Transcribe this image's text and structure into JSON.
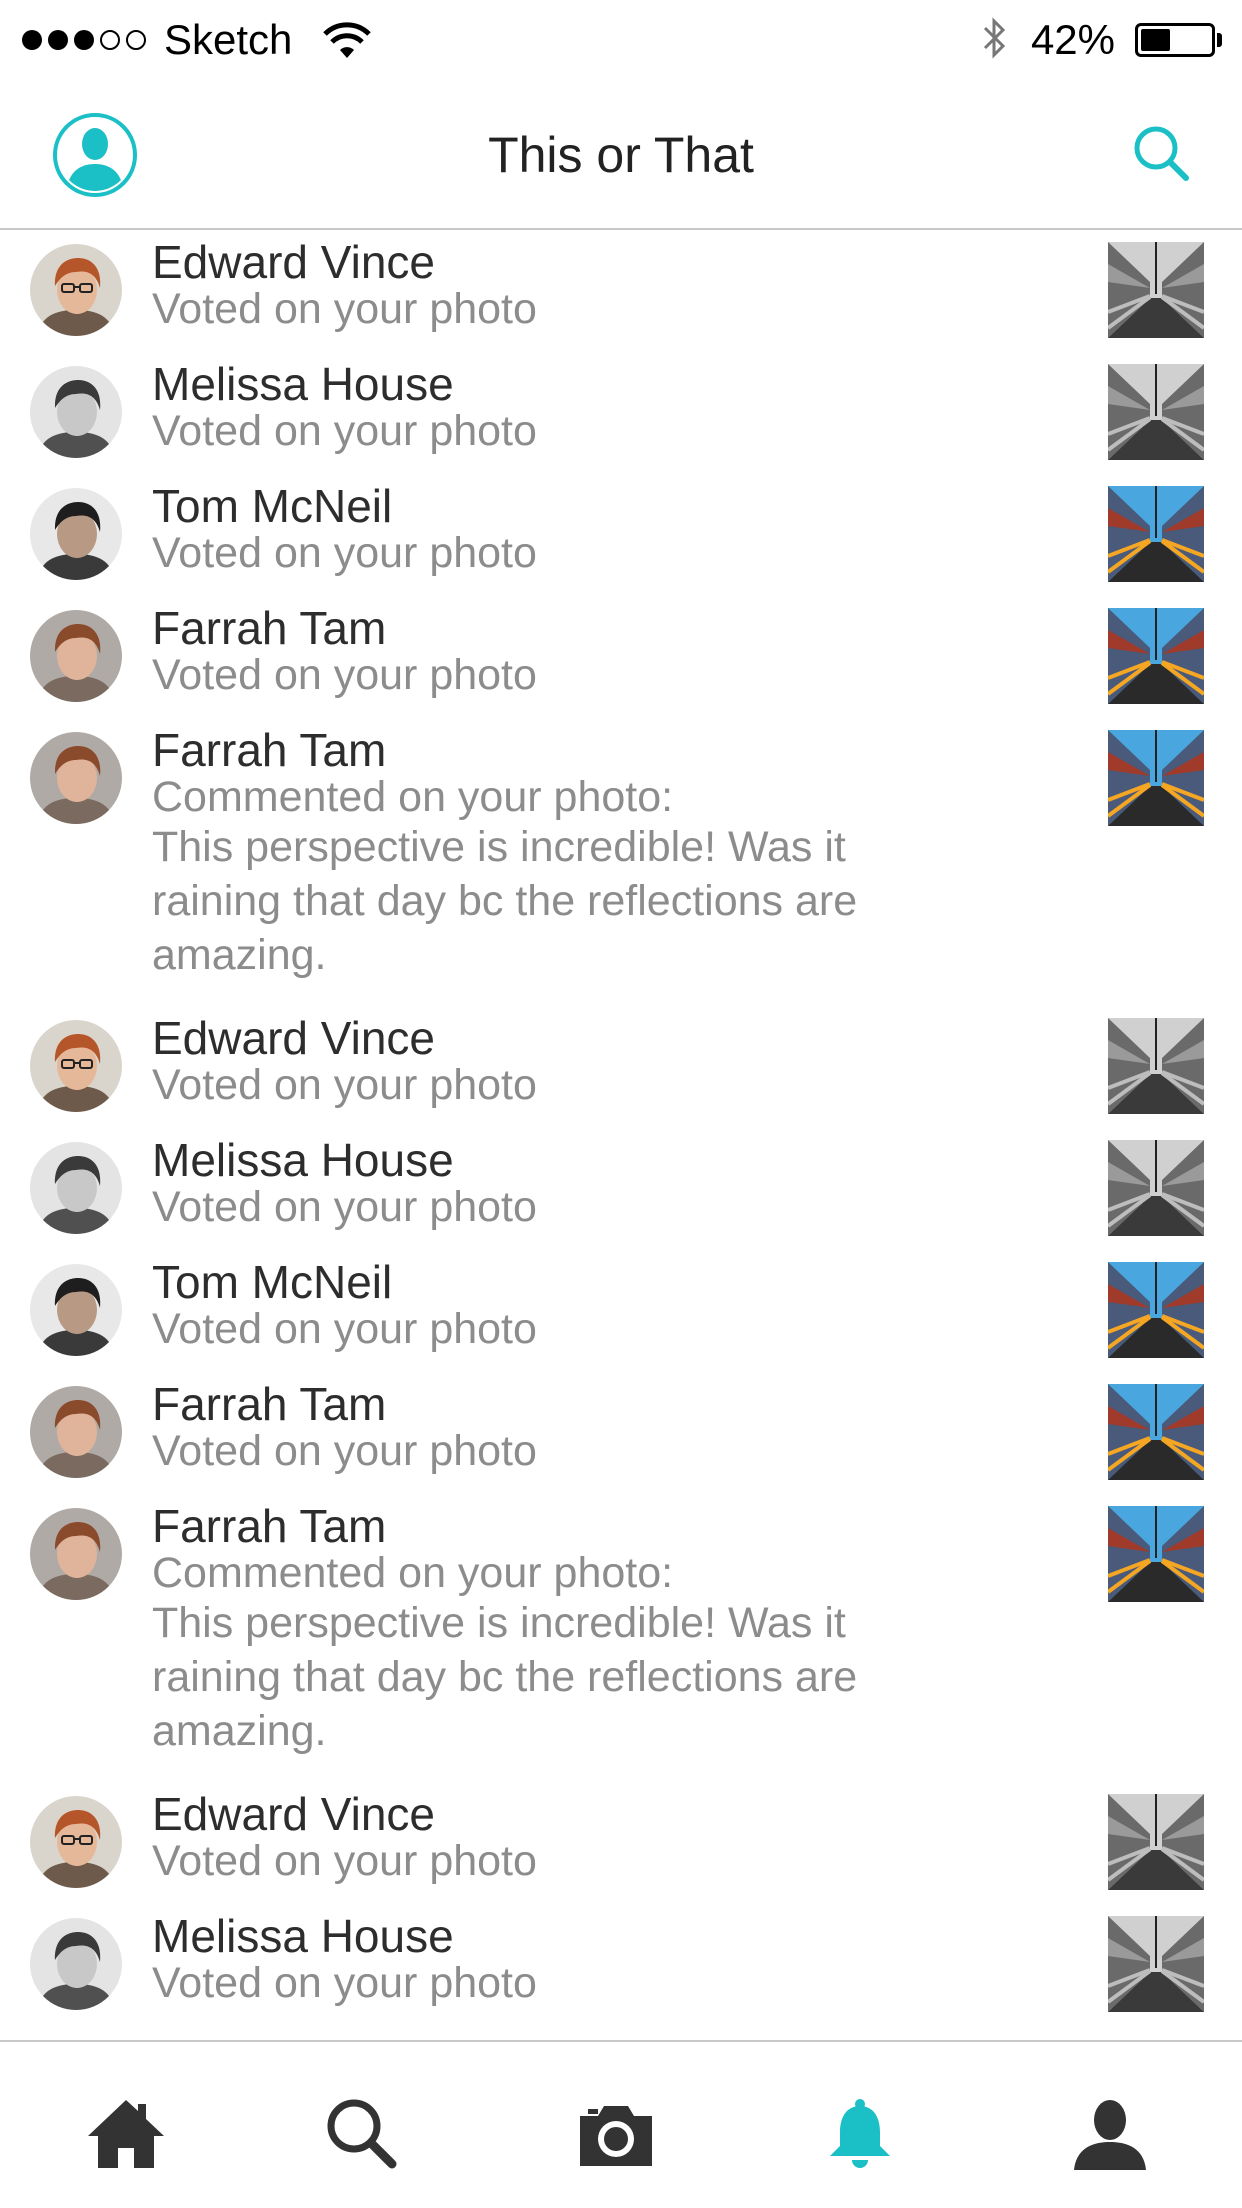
{
  "status_bar": {
    "carrier": "Sketch",
    "battery": "42%",
    "battery_level": 0.42
  },
  "nav": {
    "title": "This or That",
    "left_icon": "profile-avatar-icon",
    "right_icon": "search-icon"
  },
  "colors": {
    "accent": "#1bbfc6",
    "text_primary": "#2d2d2d",
    "text_secondary": "#8c8c8c",
    "divider": "#c8c8c8",
    "tab_icon": "#333333"
  },
  "notifications": [
    {
      "name": "Edward Vince",
      "action": "Voted on your photo",
      "avatar": "edward",
      "thumb": "gray"
    },
    {
      "name": "Melissa House",
      "action": "Voted on your photo",
      "avatar": "melissa",
      "thumb": "gray"
    },
    {
      "name": "Tom McNeil",
      "action": "Voted on your photo",
      "avatar": "tom",
      "thumb": "color"
    },
    {
      "name": "Farrah Tam",
      "action": "Voted on your photo",
      "avatar": "farrah",
      "thumb": "color"
    },
    {
      "name": "Farrah Tam",
      "action": "Commented on your photo:",
      "comment": "This perspective is incredible! Was it raining that day bc the reflections are amazing.",
      "avatar": "farrah",
      "thumb": "color"
    },
    {
      "name": "Edward Vince",
      "action": "Voted on your photo",
      "avatar": "edward",
      "thumb": "gray"
    },
    {
      "name": "Melissa House",
      "action": "Voted on your photo",
      "avatar": "melissa",
      "thumb": "gray"
    },
    {
      "name": "Tom McNeil",
      "action": "Voted on your photo",
      "avatar": "tom",
      "thumb": "color"
    },
    {
      "name": "Farrah Tam",
      "action": "Voted on your photo",
      "avatar": "farrah",
      "thumb": "color"
    },
    {
      "name": "Farrah Tam",
      "action": "Commented on your photo:",
      "comment": "This perspective is incredible! Was it raining that day bc the reflections are amazing.",
      "avatar": "farrah",
      "thumb": "color"
    },
    {
      "name": "Edward Vince",
      "action": "Voted on your photo",
      "avatar": "edward",
      "thumb": "gray"
    },
    {
      "name": "Melissa House",
      "action": "Voted on your photo",
      "avatar": "melissa",
      "thumb": "gray"
    }
  ],
  "tabs": [
    {
      "icon": "home-icon",
      "active": false
    },
    {
      "icon": "search-icon",
      "active": false
    },
    {
      "icon": "camera-icon",
      "active": false
    },
    {
      "icon": "bell-icon",
      "active": true
    },
    {
      "icon": "profile-icon",
      "active": false
    }
  ]
}
